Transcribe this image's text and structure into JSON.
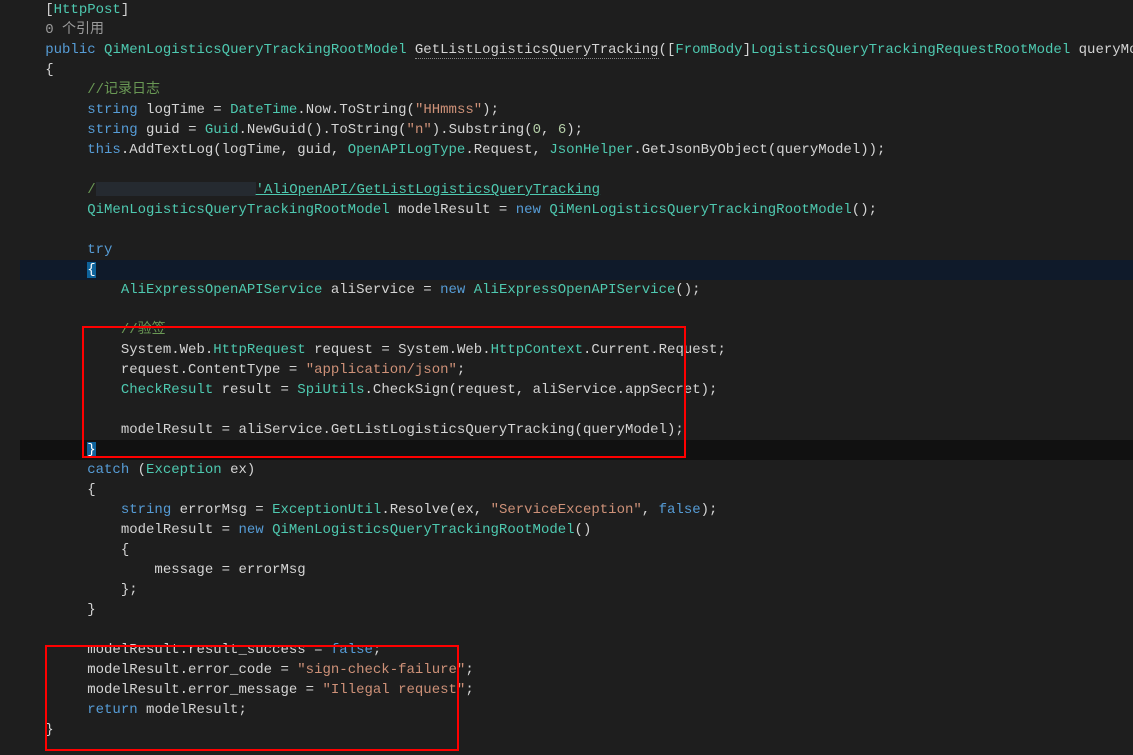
{
  "attr": {
    "http_post": "HttpPost",
    "from_body": "FromBody"
  },
  "ref": {
    "count": "0 个引用"
  },
  "kw": {
    "public": "public",
    "string": "string",
    "this": "this",
    "try": "try",
    "catch": "catch",
    "new": "new",
    "return": "return",
    "false": "false"
  },
  "types": {
    "ret": "QiMenLogisticsQueryTrackingRootModel",
    "param": "LogisticsQueryTrackingRequestRootModel",
    "DateTime": "DateTime",
    "Guid": "Guid",
    "OpenAPILogType": "OpenAPILogType",
    "JsonHelper": "JsonHelper",
    "AliExpressOpenAPIService": "AliExpressOpenAPIService",
    "HttpRequest": "HttpRequest",
    "HttpContext": "HttpContext",
    "CheckResult": "CheckResult",
    "SpiUtils": "SpiUtils",
    "Exception": "Exception",
    "ExceptionUtil": "ExceptionUtil"
  },
  "ids": {
    "method": "GetListLogisticsQueryTracking",
    "queryModel": "queryModel",
    "logTime": "logTime",
    "guid": "guid",
    "modelResult": "modelResult",
    "aliService": "aliService",
    "request": "request",
    "result": "result",
    "ex": "ex",
    "errorMsg": "errorMsg",
    "NewGuid": "NewGuid",
    "ToString": "ToString",
    "Substring": "Substring",
    "Now": "Now",
    "AddTextLog": "AddTextLog",
    "Request": "Request",
    "GetJsonByObject": "GetJsonByObject",
    "ContentType": "ContentType",
    "Current": "Current",
    "CheckSign": "CheckSign",
    "appSecret": "appSecret",
    "Resolve": "Resolve",
    "message": "message",
    "result_success": "result_success",
    "error_code": "error_code",
    "error_message": "error_message",
    "System": "System",
    "Web": "Web"
  },
  "comments": {
    "log": "//记录日志",
    "verify": "//验签",
    "prefix": "/"
  },
  "link": {
    "text": "'AliOpenAPI/GetListLogisticsQueryTracking"
  },
  "strings": {
    "hhmmss": "\"HHmmss\"",
    "n": "\"n\"",
    "appjson": "\"application/json\"",
    "svcexc": "\"ServiceException\"",
    "signfail": "\"sign-check-failure\"",
    "illegal": "\"Illegal request\""
  },
  "nums": {
    "zero": "0",
    "six": "6"
  },
  "redbox": {
    "top1": 326,
    "left1": 82,
    "w1": 600,
    "h1": 128,
    "top2": 645,
    "left2": 45,
    "w2": 410,
    "h2": 102
  }
}
